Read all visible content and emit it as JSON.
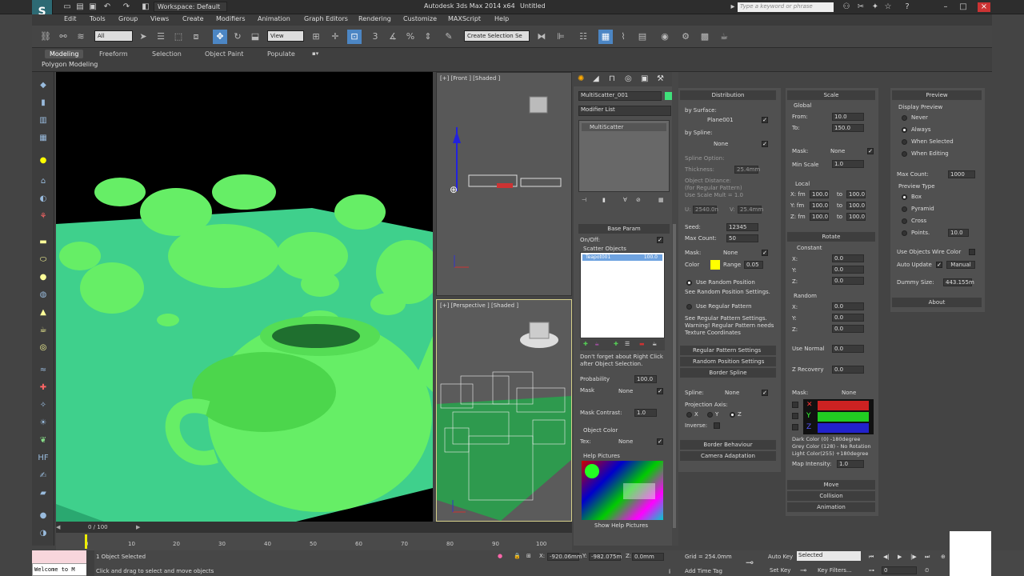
{
  "app": {
    "title": "Autodesk 3ds Max 2014 x64",
    "document": "Untitled",
    "workspace": "Workspace: Default",
    "search_placeholder": "Type a keyword or phrase",
    "logo": "3ds Max logo"
  },
  "menu": [
    "Edit",
    "Tools",
    "Group",
    "Views",
    "Create",
    "Modifiers",
    "Animation",
    "Graph Editors",
    "Rendering",
    "Customize",
    "MAXScript",
    "Help"
  ],
  "toolbar": {
    "filter": "All",
    "ref_coord": "View",
    "selection_set": "Create Selection Se",
    "icons": [
      "select-link-icon",
      "unlink-icon",
      "bind-spacewarp-icon",
      "select-object-icon",
      "select-by-name-icon",
      "rect-selection-icon",
      "window-crossing-icon",
      "move-icon",
      "rotate-icon",
      "scale-icon",
      "pivot-icon",
      "snap-icon",
      "angle-snap-icon",
      "percent-snap-icon",
      "spinner-snap-icon",
      "named-sets-icon",
      "mirror-icon",
      "align-icon",
      "layer-icon",
      "graphite-icon",
      "curve-editor-icon",
      "schematic-icon",
      "material-editor-icon",
      "render-setup-icon",
      "rendered-frame-icon",
      "render-icon"
    ]
  },
  "ribbon": {
    "tabs": [
      "Modeling",
      "Freeform",
      "Selection",
      "Object Paint",
      "Populate"
    ],
    "active": "Modeling",
    "sub": "Polygon Modeling"
  },
  "viewports": {
    "front": "[+] [Front ] [Shaded ]",
    "perspective": "[+] [Perspective ] [Shaded ]"
  },
  "command_panel": {
    "object_name": "MultiScatter_001",
    "modifier_list": "Modifier List",
    "stack_item": "MultiScatter",
    "base_param": "Base Param",
    "onoff": "On/Off:",
    "scatter_objects": "Scatter Objects",
    "scatter_item": "Teapot001",
    "scatter_pct": "100.0",
    "note": "Don't forget about Right Click after Object Selection.",
    "probability_label": "Probability",
    "probability": "100.0",
    "mask_label": "Mask",
    "mask": "None",
    "mask_contrast_label": "Mask Contrast:",
    "mask_contrast": "1.0",
    "object_color": "Object Color",
    "tex_label": "Tex:",
    "tex": "None",
    "help_pictures": "Help Pictures",
    "show_help": "Show Help Pictures"
  },
  "distribution": {
    "title": "Distribution",
    "by_surface": "by Surface:",
    "surface": "Plane001",
    "by_spline": "by Spline:",
    "spline": "None",
    "spline_option": "Spline Option:",
    "thickness_label": "Thickness:",
    "thickness": "25.4mm",
    "object_distance": "Object Distance:",
    "for_regular": "(for Regular Pattern)",
    "use_scale_mult": "Use Scale Mult = 1.0",
    "u_label": "U:",
    "u": "2540.0n",
    "v_label": "V:",
    "v": "25.4mm",
    "seed_label": "Seed:",
    "seed": "12345",
    "max_count_label": "Max Count:",
    "max_count": "50",
    "mask_label": "Mask:",
    "mask": "None",
    "color_label": "Color",
    "range_label": "Range",
    "range": "0.05",
    "use_random": "Use Random Position",
    "see_random": "See Random Position Settings.",
    "use_regular": "Use Regular Pattern",
    "see_regular": "See Regular Pattern Settings. Warning! Regular Pattern needs Texture Coordinates",
    "regular_rollout": "Regular Pattern Settings",
    "random_rollout": "Random Position Settings",
    "border_spline": "Border Spline",
    "spline_label": "Spline:",
    "spline2": "None",
    "projection_axis": "Projection Axis:",
    "axes": [
      "X",
      "Y",
      "Z"
    ],
    "inverse": "Inverse:",
    "border_behaviour": "Border Behaviour",
    "camera_adaptation": "Camera Adaptation"
  },
  "scale": {
    "title": "Scale",
    "global": "Global",
    "from_label": "From:",
    "from": "10.0",
    "to_label": "To:",
    "to": "150.0",
    "mask_label": "Mask:",
    "mask": "None",
    "min_scale_label": "Min Scale",
    "min_scale": "1.0",
    "local": "Local",
    "x_fm": "X: fm",
    "y_fm": "Y: fm",
    "z_fm": "Z: fm",
    "local_from": "100.0",
    "local_to": "100.0",
    "to_word": "to",
    "rotate": "Rotate",
    "constant": "Constant",
    "random": "Random",
    "x": "X:",
    "y": "Y:",
    "z": "Z:",
    "zero": "0.0",
    "use_normal": "Use Normal",
    "z_recovery": "Z Recovery",
    "mask2": "None",
    "dark_color": "Dark Color (0)   -180degree",
    "grey_color": "Grey Color (128)  - No Rotation",
    "light_color": "Light Color(255)  +180degree",
    "map_intensity_label": "Map Intensity:",
    "map_intensity": "1.0",
    "move": "Move",
    "collision": "Collision",
    "animation": "Animation"
  },
  "preview": {
    "title": "Preview",
    "display_preview": "Display Preview",
    "options": [
      "Never",
      "Always",
      "When Selected",
      "When Editing"
    ],
    "max_count_label": "Max Count:",
    "max_count": "1000",
    "preview_type": "Preview Type",
    "types": [
      "Box",
      "Pyramid",
      "Cross",
      "Points."
    ],
    "points": "10.0",
    "use_wire": "Use Objects Wire Color",
    "auto_update": "Auto Update",
    "manual": "Manual",
    "dummy_size_label": "Dummy Size:",
    "dummy_size": "443.155m",
    "about": "About"
  },
  "timeline": {
    "frame": "0 / 100",
    "ticks": [
      "0",
      "10",
      "20",
      "30",
      "40",
      "50",
      "60",
      "70",
      "80",
      "90",
      "100"
    ]
  },
  "status": {
    "maxscript": "Welcome to M",
    "selected": "1 Object Selected",
    "prompt": "Click and drag to select and move objects",
    "x_label": "X:",
    "x": "-920.06mm",
    "y_label": "Y:",
    "y": "-982.075m",
    "z_label": "Z:",
    "z": "0.0mm",
    "grid": "Grid = 254.0mm",
    "add_time_tag": "Add Time Tag",
    "auto_key": "Auto Key",
    "selected_dd": "Selected",
    "set_key": "Set Key",
    "key_filters": "Key Filters...",
    "frame_val": "0"
  }
}
